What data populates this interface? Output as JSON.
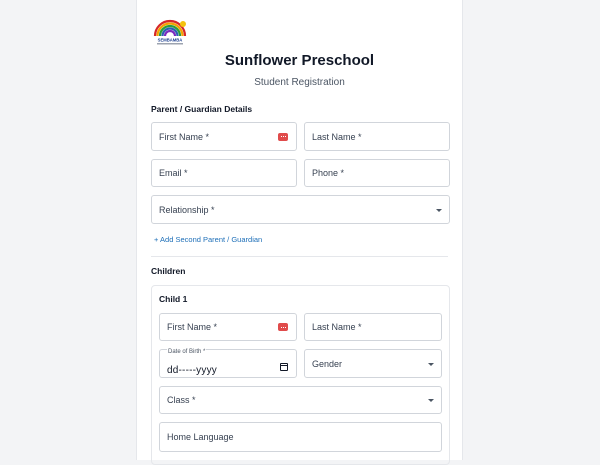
{
  "school": {
    "logo_text": "SEMBAMBA",
    "name": "Sunflower Preschool",
    "subtitle": "Student Registration"
  },
  "parent": {
    "heading": "Parent / Guardian Details",
    "first_name_placeholder": "First Name *",
    "last_name_placeholder": "Last Name *",
    "email_placeholder": "Email *",
    "phone_placeholder": "Phone *",
    "relationship_placeholder": "Relationship *",
    "add_second_link": "+ Add Second Parent / Guardian"
  },
  "children": {
    "heading": "Children",
    "child1": {
      "heading": "Child 1",
      "first_name_placeholder": "First Name *",
      "last_name_placeholder": "Last Name *",
      "dob_label": "Date of Birth *",
      "dob_value": "dd-----yyyy",
      "gender_placeholder": "Gender",
      "class_placeholder": "Class *",
      "home_language_placeholder": "Home Language"
    }
  },
  "colors": {
    "autofill_badge": "#e04b4b",
    "link": "#1e6fb8"
  },
  "icons": {
    "autofill": "autofill-badge-icon",
    "dropdown": "chevron-down-icon",
    "calendar": "calendar-icon"
  }
}
